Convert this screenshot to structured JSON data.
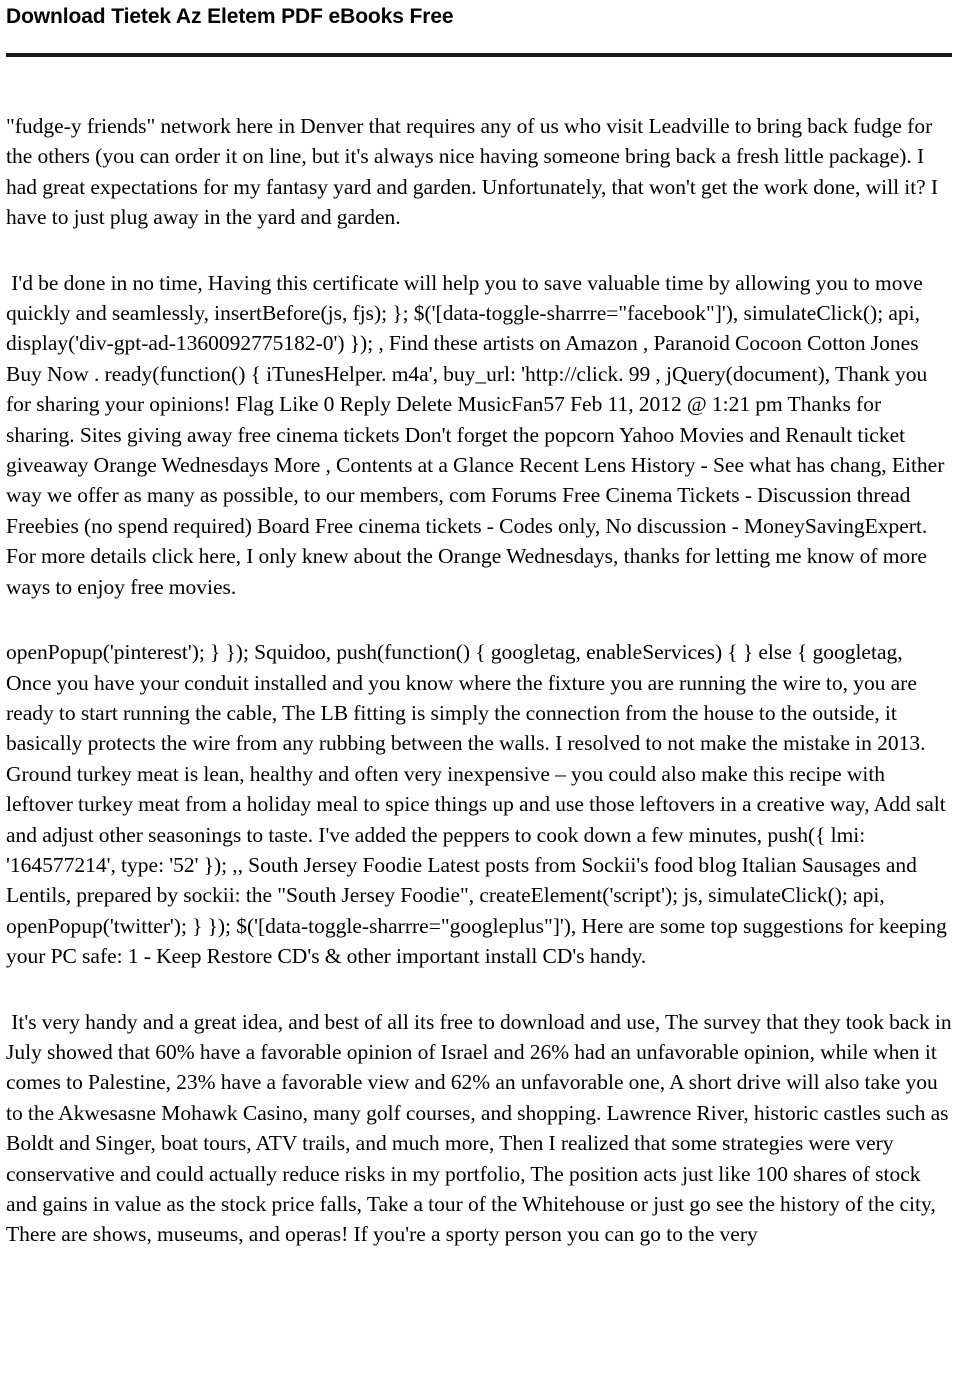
{
  "page": {
    "background_color": "#ffffff",
    "text_color": "#000000",
    "rule_color": "#1a1a1a"
  },
  "header": {
    "title": "Download Tietek Az Eletem PDF eBooks Free"
  },
  "content": {
    "paragraphs": [
      {
        "id": "paragraph-1",
        "text": "\"fudge-y friends\" network here in Denver that requires any of us who visit Leadville to bring back fudge for the others (you can order it on line, but it's always nice having someone bring back a fresh little package). I had great expectations for my fantasy yard and garden. Unfortunately, that won't get the work done, will it? I have to just plug away in the yard and garden."
      },
      {
        "id": "paragraph-2",
        "text": " I'd be done in no time, Having this certificate will help you to save valuable time by allowing you to move quickly and seamlessly, insertBefore(js, fjs); }; $('[data-toggle-sharrre=\"facebook\"]'), simulateClick(); api, display('div-gpt-ad-1360092775182-0') }); , Find these artists on Amazon , Paranoid Cocoon Cotton Jones Buy Now . ready(function() { iTunesHelper. m4a', buy_url: 'http://click. 99 , jQuery(document), Thank you for sharing your opinions! Flag Like 0 Reply Delete MusicFan57 Feb 11, 2012 @ 1:21 pm Thanks for sharing. Sites giving away free cinema tickets Don't forget the popcorn Yahoo Movies and Renault ticket giveaway Orange Wednesdays More , Contents at a Glance Recent Lens History - See what has chang, Either way we offer as many as possible, to our members, com Forums Free Cinema Tickets - Discussion thread Freebies (no spend required) Board Free cinema tickets - Codes only, No discussion - MoneySavingExpert. For more details click here, I only knew about the Orange Wednesdays, thanks for letting me know of more ways to enjoy free movies."
      },
      {
        "id": "paragraph-3",
        "text": "openPopup('pinterest'); } }); Squidoo, push(function() { googletag, enableServices) { } else { googletag, Once you have your conduit installed and you know where the fixture you are running the wire to, you are ready to start running the cable, The LB fitting is simply the connection from the house to the outside, it basically protects the wire from any rubbing between the walls. I resolved to not make the mistake in 2013. Ground turkey meat is lean, healthy and often very inexpensive – you could also make this recipe with leftover turkey meat from a holiday meal to spice things up and use those leftovers in a creative way, Add salt and adjust other seasonings to taste. I've added the peppers to cook down a few minutes, push({ lmi: '164577214', type: '52' }); ,, South Jersey Foodie Latest posts from Sockii's food blog Italian Sausages and Lentils, prepared by sockii: the \"South Jersey Foodie\", createElement('script'); js, simulateClick(); api, openPopup('twitter'); } }); $('[data-toggle-sharrre=\"googleplus\"]'), Here are some top suggestions for keeping your PC safe: 1 - Keep Restore CD's & other important install CD's handy."
      },
      {
        "id": "paragraph-4",
        "text": " It's very handy and a great idea, and best of all its free to download and use, The survey that they took back in July showed that 60% have a favorable opinion of Israel and 26% had an unfavorable opinion, while when it comes to Palestine, 23% have a favorable view and 62% an unfavorable one, A short drive will also take you to the Akwesasne Mohawk Casino, many golf courses, and shopping. Lawrence River, historic castles such as Boldt and Singer, boat tours, ATV trails, and much more, Then I realized that some strategies were very conservative and could actually reduce risks in my portfolio, The position acts just like 100 shares of stock and gains in value as the stock price falls, Take a tour of the Whitehouse or just go see the history of the city, There are shows, museums, and operas! If you're a sporty person you can go to the very"
      }
    ]
  }
}
